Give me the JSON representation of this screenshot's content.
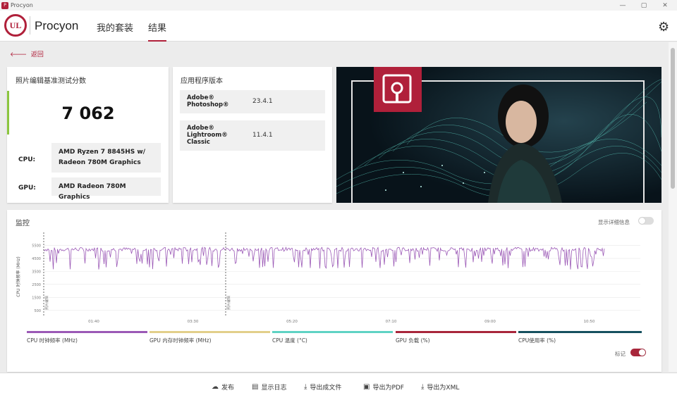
{
  "window": {
    "title": "Procyon",
    "min": "—",
    "max": "▢",
    "close": "✕"
  },
  "header": {
    "logo_text": "UL",
    "brand": "Procyon",
    "tabs": [
      {
        "label": "我的套装"
      },
      {
        "label": "结果"
      }
    ],
    "active_tab": 1
  },
  "back_link": "返回",
  "score_card": {
    "title": "照片编辑基准测试分数",
    "score": "7 062",
    "cpu_label": "CPU:",
    "cpu_value": "AMD Ryzen 7 8845HS w/ Radeon 780M Graphics",
    "gpu_label": "GPU:",
    "gpu_value": "AMD Radeon 780M Graphics"
  },
  "versions_card": {
    "title": "应用程序版本",
    "apps": [
      {
        "name": "Adobe® Photoshop®",
        "version": "23.4.1"
      },
      {
        "name": "Adobe® Lightroom® Classic",
        "version": "11.4.1"
      }
    ]
  },
  "monitor": {
    "title": "监控",
    "details_toggle_label": "显示详细信息",
    "ylabel": "CPU 时钟频率 (MHz)",
    "marks_toggle_label": "标记",
    "legend": [
      {
        "label": "CPU 时钟频率 (MHz)",
        "color": "#9b59b6"
      },
      {
        "label": "GPU 内存时钟频率 (MHz)",
        "color": "#e2cf8a"
      },
      {
        "label": "CPU 温度 (°C)",
        "color": "#5fd3c4"
      },
      {
        "label": "GPU 负载 (%)",
        "color": "#a8263b"
      },
      {
        "label": "CPU使用率 (%)",
        "color": "#16505f"
      }
    ]
  },
  "chart_data": {
    "type": "line",
    "ylabel": "CPU 时钟频率 (MHz)",
    "y_ticks": [
      500,
      1500,
      2500,
      3500,
      4500,
      5500
    ],
    "x_ticks": [
      "01:40",
      "03:30",
      "05:20",
      "07:10",
      "09:00",
      "10:50"
    ],
    "ylim": [
      0,
      6500
    ],
    "marker_labels": [
      "照片编辑",
      "照片编辑"
    ],
    "grid": true
  },
  "footer": {
    "buttons": [
      {
        "label": "发布",
        "icon": "cloud-icon"
      },
      {
        "label": "显示日志",
        "icon": "log-icon"
      },
      {
        "label": "导出成文件",
        "icon": "download-icon"
      },
      {
        "label": "导出为PDF",
        "icon": "save-icon"
      },
      {
        "label": "导出为XML",
        "icon": "download-icon"
      }
    ]
  },
  "colors": {
    "accent": "#b0203a",
    "score_bar": "#8cc63f",
    "cpu_line": "#9b59b6"
  }
}
